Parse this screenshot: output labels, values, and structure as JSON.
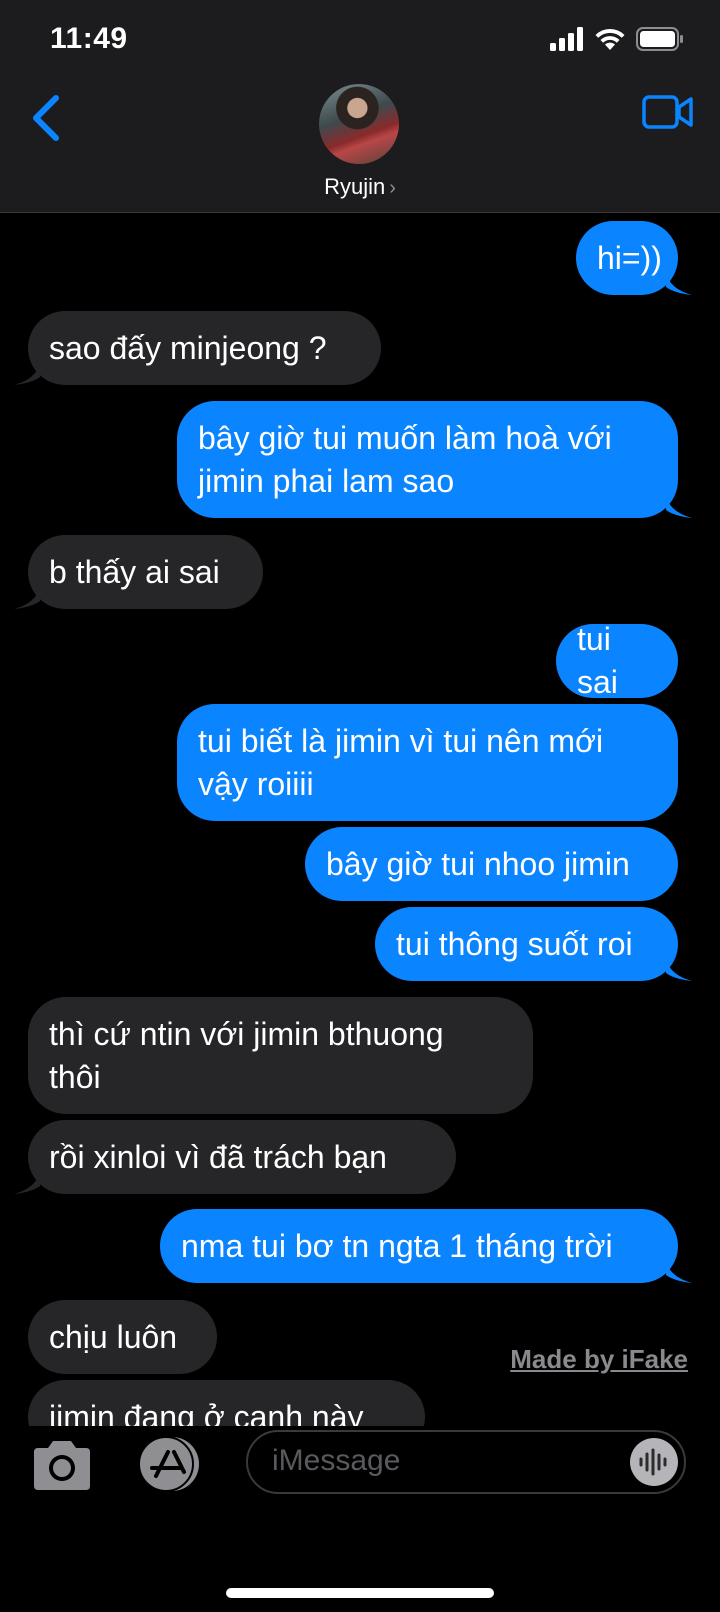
{
  "status_bar": {
    "time": "11:49"
  },
  "header": {
    "contact_name": "Ryujin",
    "name_chevron": "›"
  },
  "messages": [
    {
      "dir": "out",
      "text": "hi=))"
    },
    {
      "dir": "in",
      "text": "sao đấy minjeong ?"
    },
    {
      "dir": "out",
      "text": "bây giờ tui muốn làm hoà với\njimin phai lam sao"
    },
    {
      "dir": "in",
      "text": "b thấy ai sai"
    },
    {
      "dir": "out",
      "text": "tui sai"
    },
    {
      "dir": "out",
      "text": "tui biết là jimin vì tui nên mới\nvậy roiiii"
    },
    {
      "dir": "out",
      "text": "bây giờ tui nhoo jimin"
    },
    {
      "dir": "out",
      "text": "tui thông suốt roi"
    },
    {
      "dir": "in",
      "text": "thì cứ ntin với jimin bthuong\nthôi"
    },
    {
      "dir": "in",
      "text": "rồi xinloi vì đã trách bạn"
    },
    {
      "dir": "out",
      "text": "nma tui bơ tn ngta 1 tháng trời"
    },
    {
      "dir": "in",
      "text": "chịu luôn"
    },
    {
      "dir": "in",
      "text": "jimin đang ở cạnh này"
    }
  ],
  "watermark": "Made by iFake",
  "composer": {
    "placeholder": "iMessage"
  },
  "icons": {
    "back": "chevron-left-icon",
    "video": "video-camera-icon",
    "camera": "camera-icon",
    "appstore": "app-store-icon",
    "audio": "waveform-icon"
  },
  "colors": {
    "outgoing": "#0a84ff",
    "incoming": "#262628",
    "accent": "#0a84ff",
    "background": "#000000"
  }
}
